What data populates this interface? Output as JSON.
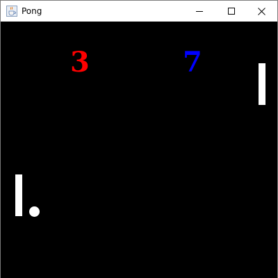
{
  "window": {
    "title": "Pong",
    "icon": "java-cup-icon"
  },
  "game": {
    "score_left": "3",
    "score_right": "7",
    "colors": {
      "background": "#000000",
      "score_left": "#ff0000",
      "score_right": "#0000ff",
      "paddles": "#ffffff",
      "ball": "#ffffff"
    }
  }
}
